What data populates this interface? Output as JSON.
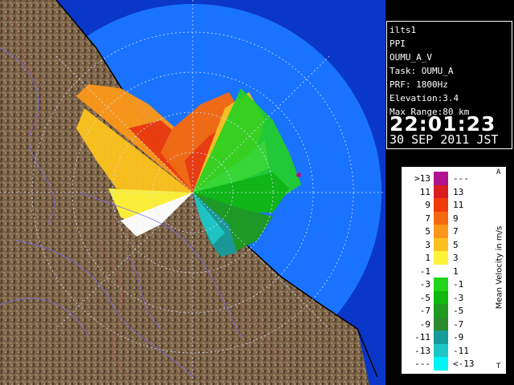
{
  "info": {
    "site": "ilts1",
    "scan_type": "PPI",
    "product": "OUMU_A_V",
    "task": "Task: OUMU_A",
    "prf": "PRF: 1800Hz",
    "elevation": "Elevation:3.4",
    "max_range": "Max Range:80 km",
    "time": "22:01:23",
    "date": "30 SEP 2011 JST"
  },
  "legend": {
    "title": "Mean Velocity in m/s",
    "corner_top": "A",
    "corner_bottom": "T",
    "bins": [
      {
        "low": ">13",
        "high": "---",
        "color": "#b0128f"
      },
      {
        "low": "11",
        "high": "13",
        "color": "#d81e1e"
      },
      {
        "low": "9",
        "high": "11",
        "color": "#ee3c0c"
      },
      {
        "low": "7",
        "high": "9",
        "color": "#f56a10"
      },
      {
        "low": "5",
        "high": "7",
        "color": "#f9971a"
      },
      {
        "low": "3",
        "high": "5",
        "color": "#fbc11f"
      },
      {
        "low": "1",
        "high": "3",
        "color": "#fef23a"
      },
      {
        "low": "-1",
        "high": "1",
        "color": "#ffffff"
      },
      {
        "low": "-3",
        "high": "-1",
        "color": "#22d51a"
      },
      {
        "low": "-5",
        "high": "-3",
        "color": "#10b810"
      },
      {
        "low": "-7",
        "high": "-5",
        "color": "#1f9a1f"
      },
      {
        "low": "-9",
        "high": "-7",
        "color": "#2c8b2c"
      },
      {
        "low": "-11",
        "high": "-9",
        "color": "#169a9a"
      },
      {
        "low": "-13",
        "high": "-11",
        "color": "#1cc7c7"
      },
      {
        "low": "---",
        "high": "<-13",
        "color": "#00f4f4"
      }
    ]
  },
  "colors": {
    "sea": "#1a73ff",
    "sea_outer": "#0c3fd0",
    "land": "#7a6248",
    "range_rings": "#ffffff"
  }
}
